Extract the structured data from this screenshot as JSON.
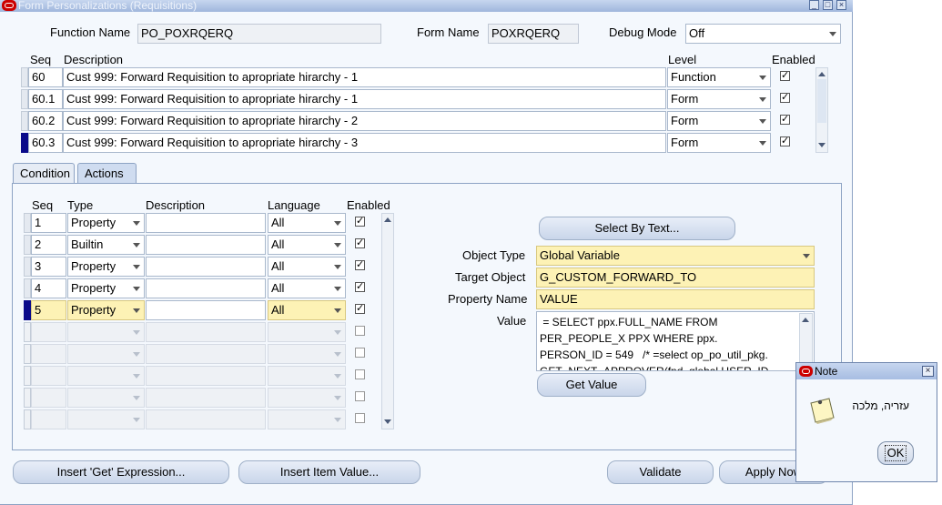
{
  "window": {
    "title": "Form Personalizations (Requisitions)"
  },
  "header": {
    "function_name_label": "Function Name",
    "function_name_value": "PO_POXRQERQ",
    "form_name_label": "Form Name",
    "form_name_value": "POXRQERQ",
    "debug_mode_label": "Debug Mode",
    "debug_mode_value": "Off"
  },
  "rules": {
    "columns": {
      "seq": "Seq",
      "description": "Description",
      "level": "Level",
      "enabled": "Enabled"
    },
    "rows": [
      {
        "seq": "60",
        "description": "Cust 999: Forward Requisition to apropriate hirarchy - 1",
        "level": "Function",
        "enabled": true
      },
      {
        "seq": "60.1",
        "description": "Cust 999: Forward Requisition to apropriate hirarchy - 1",
        "level": "Form",
        "enabled": true
      },
      {
        "seq": "60.2",
        "description": "Cust 999: Forward Requisition to apropriate hirarchy - 2",
        "level": "Form",
        "enabled": true
      },
      {
        "seq": "60.3",
        "description": "Cust 999: Forward Requisition to apropriate hirarchy - 3",
        "level": "Form",
        "enabled": true
      }
    ]
  },
  "tabs": [
    {
      "label": "Condition"
    },
    {
      "label": "Actions"
    }
  ],
  "actions": {
    "columns": {
      "seq": "Seq",
      "type": "Type",
      "description": "Description",
      "language": "Language",
      "enabled": "Enabled"
    },
    "rows": [
      {
        "seq": "1",
        "type": "Property",
        "description": "",
        "language": "All",
        "enabled": true
      },
      {
        "seq": "2",
        "type": "Builtin",
        "description": "",
        "language": "All",
        "enabled": true
      },
      {
        "seq": "3",
        "type": "Property",
        "description": "",
        "language": "All",
        "enabled": true
      },
      {
        "seq": "4",
        "type": "Property",
        "description": "",
        "language": "All",
        "enabled": true
      },
      {
        "seq": "5",
        "type": "Property",
        "description": "",
        "language": "All",
        "enabled": true
      }
    ]
  },
  "details": {
    "select_by_text": "Select By Text...",
    "object_type_label": "Object Type",
    "object_type_value": "Global Variable",
    "target_object_label": "Target Object",
    "target_object_value": "G_CUSTOM_FORWARD_TO",
    "property_name_label": "Property Name",
    "property_name_value": "VALUE",
    "value_label": "Value",
    "value_text": " = SELECT ppx.FULL_NAME FROM\nPER_PEOPLE_X PPX WHERE ppx.\nPERSON_ID = 549   /* =select op_po_util_pkg.\nGET_NEXT_APPROVER(fnd_global.USER_ID",
    "get_value": "Get Value"
  },
  "footer": {
    "insert_get": "Insert 'Get' Expression...",
    "insert_item": "Insert Item Value...",
    "validate": "Validate",
    "apply_now": "Apply Now"
  },
  "note": {
    "title": "Note",
    "message": "עזריה, מלכה",
    "ok": "OK"
  },
  "colors": {
    "required_field": "#fdf2b5",
    "current_record": "#0a0a8a",
    "oracle_red": "#cc0000"
  }
}
